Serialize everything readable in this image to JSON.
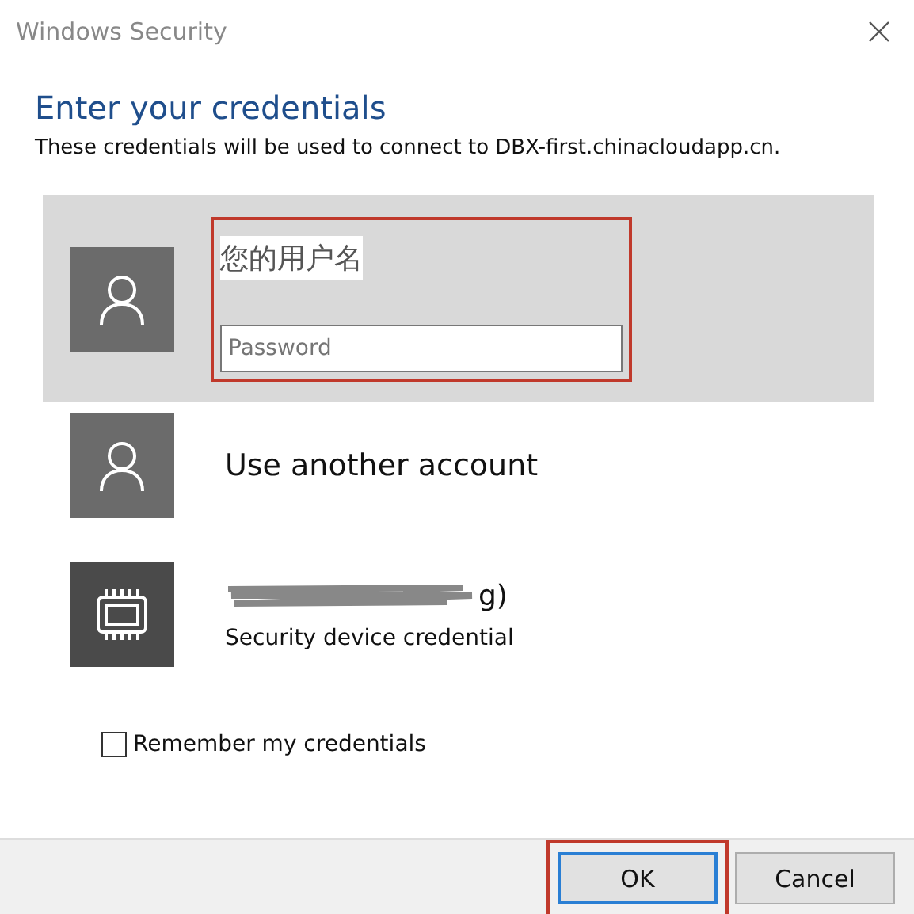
{
  "window": {
    "title": "Windows Security"
  },
  "heading": "Enter your credentials",
  "message": "These credentials will be used to connect to DBX-first.chinacloudapp.cn.",
  "accounts": [
    {
      "kind": "user",
      "selected": true,
      "annotated": true,
      "annotation": "您的用户名",
      "password_placeholder": "Password"
    },
    {
      "kind": "user",
      "selected": false,
      "name": "Use another account"
    },
    {
      "kind": "device",
      "selected": false,
      "redacted": true,
      "name": "g)",
      "description": "Security device credential"
    }
  ],
  "remember": {
    "label": "Remember my credentials",
    "checked": false
  },
  "buttons": [
    {
      "label": "OK",
      "focused": true,
      "annotated": true
    },
    {
      "label": "Cancel",
      "focused": false
    }
  ]
}
